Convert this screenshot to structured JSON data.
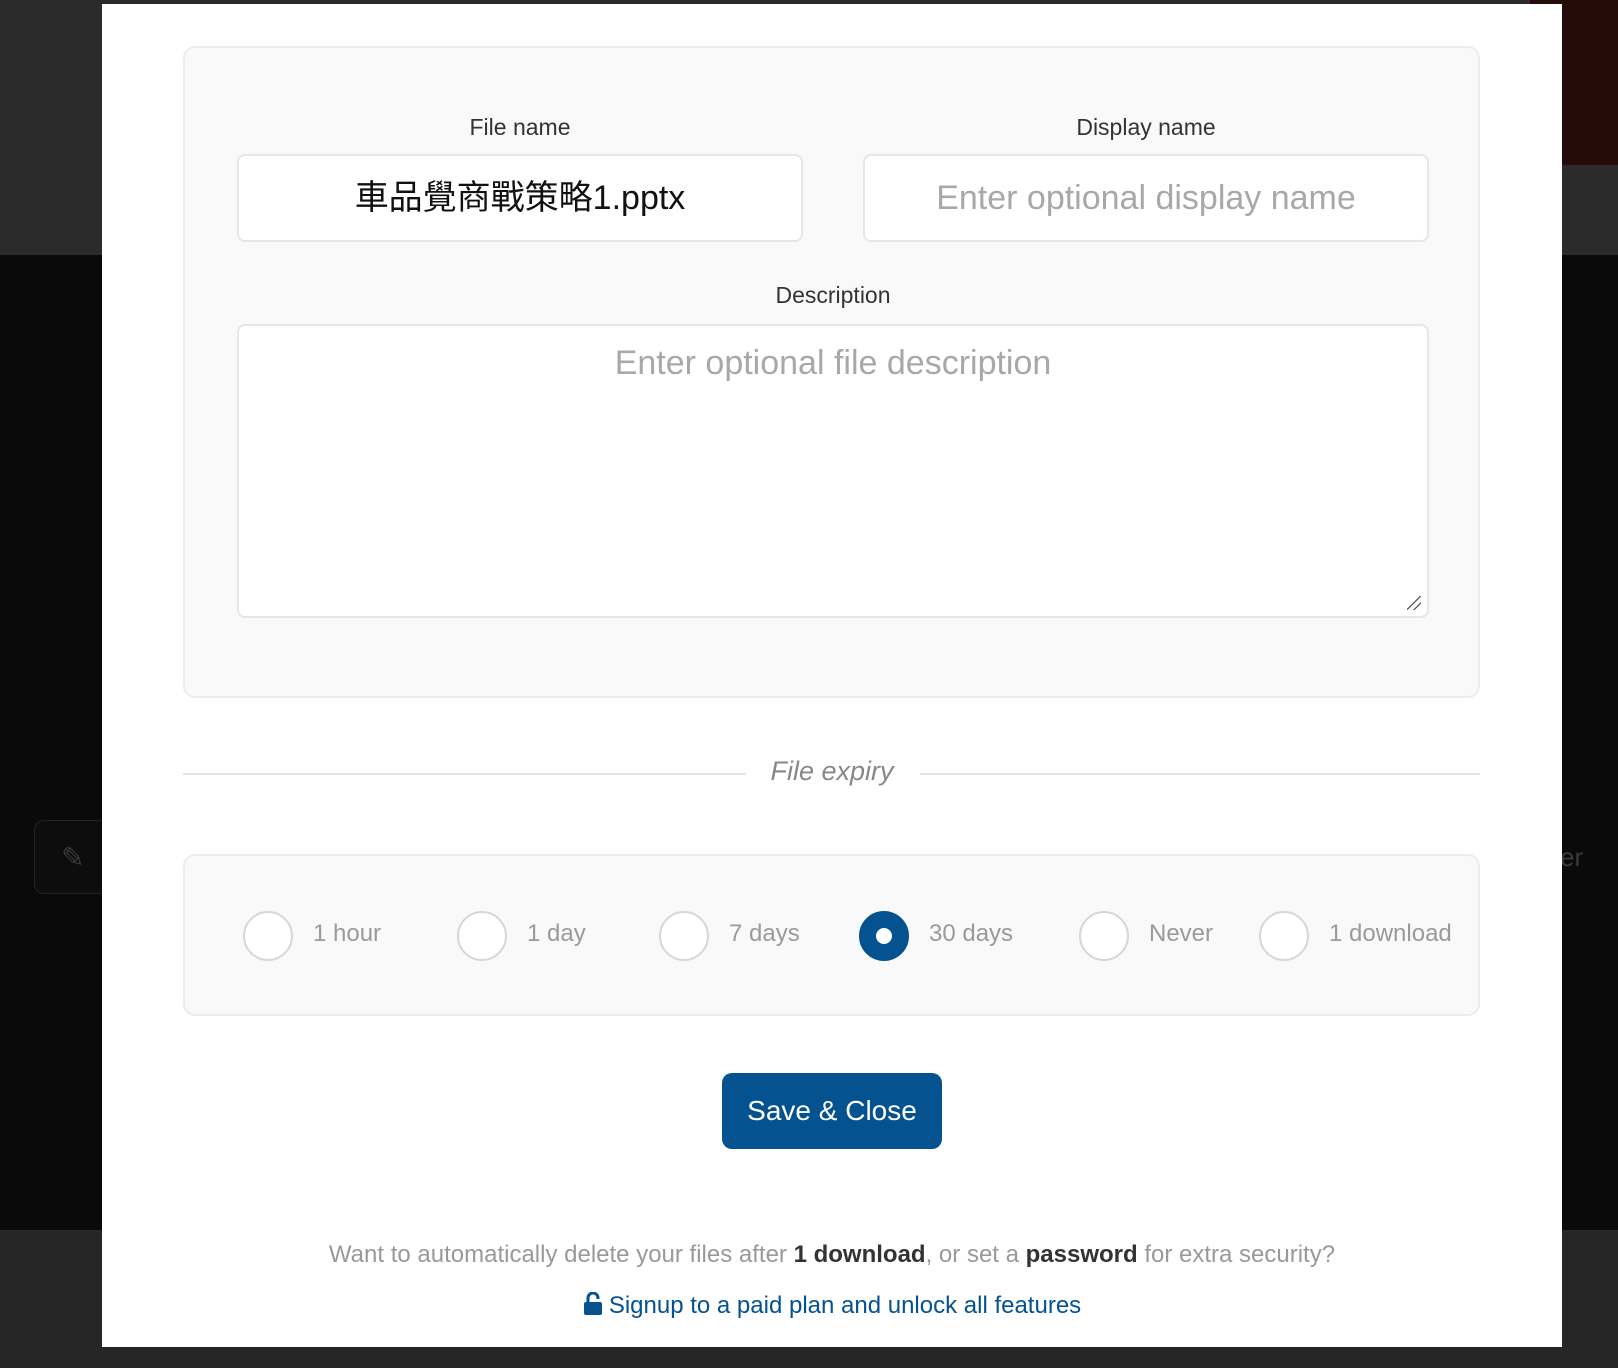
{
  "form": {
    "file_name_label": "File name",
    "file_name_value": "車品覺商戰策略1.pptx",
    "display_name_label": "Display name",
    "display_name_placeholder": "Enter optional display name",
    "description_label": "Description",
    "description_placeholder": "Enter optional file description"
  },
  "expiry": {
    "title": "File expiry",
    "options": [
      {
        "label": "1 hour",
        "selected": false
      },
      {
        "label": "1 day",
        "selected": false
      },
      {
        "label": "7 days",
        "selected": false
      },
      {
        "label": "30 days",
        "selected": true
      },
      {
        "label": "Never",
        "selected": false
      },
      {
        "label": "1 download",
        "selected": false
      }
    ]
  },
  "save_button": "Save & Close",
  "upsell": {
    "text_1": "Want to automatically delete your files after ",
    "bold_1": "1 download",
    "text_2": ", or set a ",
    "bold_2": "password",
    "text_3": " for extra security?",
    "link_icon": "unlock-icon",
    "link_label": "Signup to a paid plan and unlock all features"
  },
  "background": {
    "partial_text": "er"
  },
  "colors": {
    "accent": "#04528f"
  }
}
